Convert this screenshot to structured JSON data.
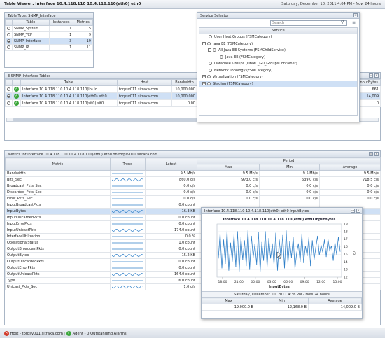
{
  "header": {
    "title": "Table Viewer: Interface 10.4.118.110 10.4.118.110(eth0) eth0",
    "datetime": "Saturday, December 10, 2011 4:04 PM - Now 24 hours"
  },
  "table_type": {
    "title": "Table Type: SNMP_Interface",
    "headers": [
      "Table",
      "Instances",
      "Metrics"
    ],
    "rows": [
      {
        "name": "SNMP_System",
        "instances": "1",
        "metrics": "5",
        "selected": false
      },
      {
        "name": "SNMP_TCP",
        "instances": "1",
        "metrics": "9",
        "selected": false
      },
      {
        "name": "SNMP_Interface",
        "instances": "3",
        "metrics": "19",
        "selected": true
      },
      {
        "name": "SNMP_IP",
        "instances": "1",
        "metrics": "11",
        "selected": false
      }
    ]
  },
  "service_selector": {
    "title": "Service Selector",
    "search_placeholder": "Search",
    "column": "Service",
    "items": [
      {
        "label": "User Host Groups (FSMCategory)",
        "indent": 0,
        "toggle": "",
        "radio": true,
        "selected": false
      },
      {
        "label": "Java EE (FSMCategory)",
        "indent": 0,
        "toggle": "-",
        "radio": true,
        "selected": false
      },
      {
        "label": "All Java EE Systems (FSMChildService)",
        "indent": 1,
        "toggle": "-",
        "radio": true,
        "selected": false
      },
      {
        "label": "Java EE (FSMCategory)",
        "indent": 2,
        "toggle": "",
        "radio": true,
        "selected": false
      },
      {
        "label": "Database Groups (DBMC_GU_GroupsContainer)",
        "indent": 0,
        "toggle": "",
        "radio": true,
        "selected": false
      },
      {
        "label": "Network Topology (FSMCategory)",
        "indent": 0,
        "toggle": "",
        "radio": true,
        "selected": false
      },
      {
        "label": "Virtualization (FSMCategory)",
        "indent": 0,
        "toggle": "+",
        "radio": true,
        "selected": false
      },
      {
        "label": "Staging (FSMCategory)",
        "indent": 0,
        "toggle": "+",
        "radio": true,
        "selected": true
      }
    ]
  },
  "snmp_tables": {
    "title": "3 SNMP_Interface Tables",
    "headers": [
      "Table",
      "Host",
      "Bandwidth",
      "InputBytes"
    ],
    "rows": [
      {
        "table": "Interface 10.4.118.110 10.4.118.110(lo) lo",
        "host": "torpsv011.sitraka.com",
        "bandwidth": "10,000,000",
        "input": "661",
        "status": "ok",
        "selected": false
      },
      {
        "table": "Interface 10.4.118.110 10.4.118.110(eth0) eth0",
        "host": "torpsv011.sitraka.com",
        "bandwidth": "10,000,000",
        "input": "14,009",
        "status": "ok",
        "selected": true
      },
      {
        "table": "Interface 10.4.118.110 10.4.118.110(sit0) sit0",
        "host": "torpsv011.sitraka.com",
        "bandwidth": "0.00",
        "input": "0",
        "status": "ok",
        "selected": false
      }
    ]
  },
  "metrics": {
    "title": "Metrics for Interface 10.4.118.110 10.4.118.110(eth0) eth0 on torpsv011.sitraka.com",
    "headers": {
      "metric": "Metric",
      "trend": "Trend",
      "latest": "Latest",
      "period": "Period",
      "max": "Max",
      "min": "Min",
      "avg": "Average"
    },
    "rows": [
      {
        "name": "Bandwidth",
        "latest": "9.5 Mb/s",
        "max": "9.5 Mb/s",
        "min": "9.5 Mb/s",
        "avg": "9.5 Mb/s",
        "trend": "flat",
        "selected": false
      },
      {
        "name": "Bits_Sec",
        "latest": "860.0 c/s",
        "max": "973.0 c/s",
        "min": "639.0 c/s",
        "avg": "718.5 c/s",
        "trend": "wave",
        "selected": false
      },
      {
        "name": "Broadcast_Pkts_Sec",
        "latest": "0.0 c/s",
        "max": "0.0 c/s",
        "min": "0.0 c/s",
        "avg": "0.0 c/s",
        "trend": "flat",
        "selected": false
      },
      {
        "name": "Discarded_Pkts_Sec",
        "latest": "0.0 c/s",
        "max": "0.0 c/s",
        "min": "0.0 c/s",
        "avg": "0.0 c/s",
        "trend": "flat",
        "selected": false
      },
      {
        "name": "Error_Pkts_Sec",
        "latest": "0.0 c/s",
        "max": "0.0 c/s",
        "min": "0.0 c/s",
        "avg": "0.0 c/s",
        "trend": "flat",
        "selected": false
      },
      {
        "name": "InputBroadcastPkts",
        "latest": "0.0 count",
        "max": "",
        "min": "",
        "avg": "",
        "trend": "flat",
        "selected": false
      },
      {
        "name": "InputBytes",
        "latest": "16.3 KB",
        "max": "",
        "min": "",
        "avg": "",
        "trend": "wave",
        "selected": true
      },
      {
        "name": "InputDiscardedPkts",
        "latest": "0.0 count",
        "max": "",
        "min": "",
        "avg": "",
        "trend": "flat",
        "selected": false
      },
      {
        "name": "InputErrorPkts",
        "latest": "0.0 count",
        "max": "",
        "min": "",
        "avg": "",
        "trend": "flat",
        "selected": false
      },
      {
        "name": "InputUnicastPkts",
        "latest": "174.0 count",
        "max": "",
        "min": "",
        "avg": "",
        "trend": "wave",
        "selected": false
      },
      {
        "name": "InterfaceUtilization",
        "latest": "0.0 %",
        "max": "",
        "min": "",
        "avg": "",
        "trend": "flat",
        "selected": false
      },
      {
        "name": "OperationalStatus",
        "latest": "1.0 count",
        "max": "",
        "min": "",
        "avg": "",
        "trend": "flat",
        "selected": false
      },
      {
        "name": "OutputBroadcastPkts",
        "latest": "0.0 count",
        "max": "",
        "min": "",
        "avg": "",
        "trend": "flat",
        "selected": false
      },
      {
        "name": "OutputBytes",
        "latest": "15.2 KB",
        "max": "",
        "min": "",
        "avg": "",
        "trend": "wave",
        "selected": false
      },
      {
        "name": "OutputDiscardedPkts",
        "latest": "0.0 count",
        "max": "",
        "min": "",
        "avg": "",
        "trend": "flat",
        "selected": false
      },
      {
        "name": "OutputErrorPkts",
        "latest": "0.0 count",
        "max": "",
        "min": "",
        "avg": "",
        "trend": "flat",
        "selected": false
      },
      {
        "name": "OutputUnicastPkts",
        "latest": "164.0 count",
        "max": "",
        "min": "",
        "avg": "",
        "trend": "wave",
        "selected": false
      },
      {
        "name": "Type",
        "latest": "6.0 count",
        "max": "",
        "min": "",
        "avg": "",
        "trend": "flat",
        "selected": false
      },
      {
        "name": "Unicast_Pkts_Sec",
        "latest": "1.0 c/s",
        "max": "",
        "min": "",
        "avg": "",
        "trend": "wave",
        "selected": false
      }
    ]
  },
  "popup": {
    "title": "Interface 10.4.118.110 10.4.118.110(eth0) eth0 InputBytes",
    "footer_date": "Saturday, December 10, 2011 4:36 PM - Now 24 hours",
    "stat_headers": [
      "Max",
      "Min",
      "Average"
    ],
    "stats": [
      "19,000.0 B",
      "12,168.0 B",
      "14,009.0 B"
    ]
  },
  "chart_data": {
    "type": "line",
    "title": "Interface 10.4.118.110 10.4.118.110(eth0) eth0 InputBytes",
    "xlabel": "InputBytes",
    "ylabel": "KB",
    "x": [
      "18:00",
      "21:00",
      "00:00",
      "03:00",
      "06:00",
      "09:00",
      "12:00",
      "15:00"
    ],
    "yticks": [
      "12",
      "13",
      "14",
      "15",
      "16",
      "17",
      "18",
      "19"
    ],
    "ylim": [
      12,
      19
    ],
    "series": [
      {
        "values": [
          14.5,
          17.8,
          13.2,
          16.9,
          13.8,
          18.1,
          12.9,
          16.5,
          14.1,
          17.6,
          13.4,
          18.0,
          12.8,
          17.2,
          14.3,
          16.8,
          13.5,
          18.2,
          13.0,
          17.4,
          14.6,
          16.3,
          13.7,
          17.9,
          12.7,
          16.6,
          14.2,
          18.0,
          13.3,
          17.1,
          14.5,
          16.4,
          13.6,
          17.8,
          12.9,
          16.9,
          14.4,
          17.5,
          13.2,
          18.1,
          13.8,
          16.7,
          14.6,
          17.3,
          13.1,
          15.2,
          16.4,
          14.0,
          17.7,
          13.9,
          16.1,
          14.8,
          17.2,
          13.5,
          16.8,
          14.3,
          15.9,
          17.4,
          14.9,
          16.2,
          15.3,
          16.9,
          14.7,
          17.0,
          15.5,
          16.1,
          14.2,
          16.6,
          15.0,
          17.3,
          15.4
        ]
      }
    ]
  },
  "statusbar": {
    "host": "Host - torpsv011.sitraka.com",
    "agent": "Agent - 0 Outstanding Alarms"
  },
  "colors": {
    "selection": "#cfe0f5",
    "ok": "#3aa63a",
    "alarm": "#d23c2c",
    "line": "#2f7fc8"
  }
}
